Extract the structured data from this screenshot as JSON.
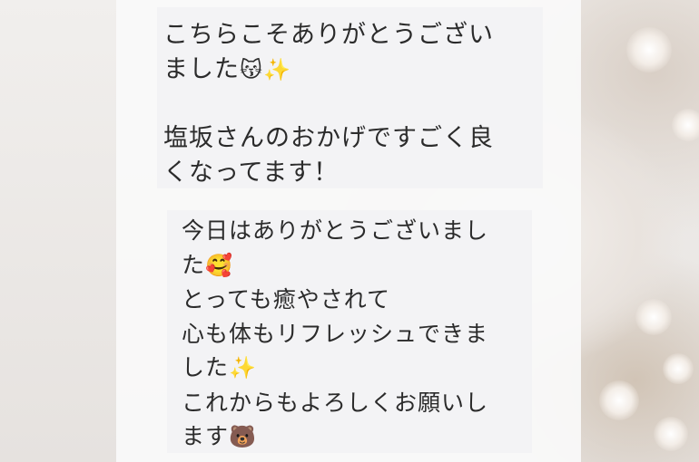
{
  "messages": [
    {
      "lines": [
        "こちらこそありがとうござい",
        "ました",
        "",
        "塩坂さんのおかげですごく良",
        "くなってます！"
      ],
      "emojis": {
        "line2": "😽✨"
      }
    },
    {
      "lines": [
        "今日はありがとうございまし",
        "た",
        "とっても癒やされて",
        "心も体もリフレッシュできま",
        "した",
        "これからもよろしくお願いし",
        "ます"
      ],
      "emojis": {
        "line2": "🥰",
        "line5": "✨",
        "line7": "🐻"
      }
    }
  ]
}
